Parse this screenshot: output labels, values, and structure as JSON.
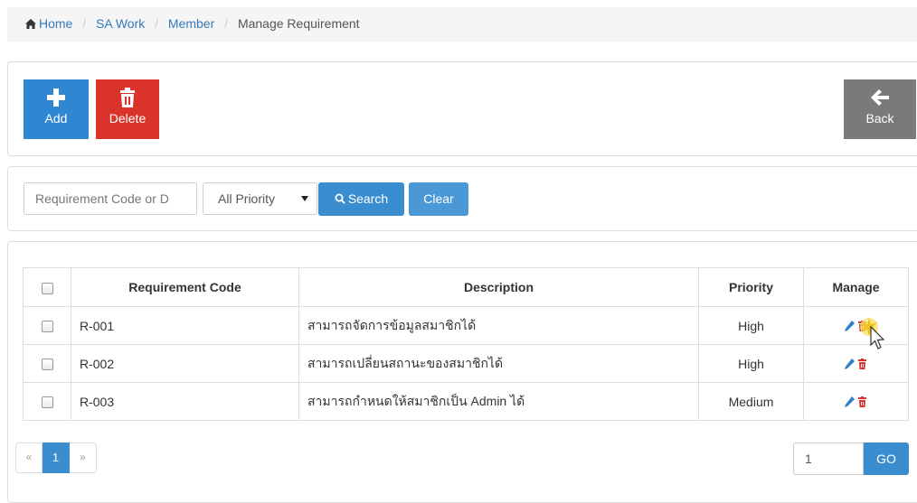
{
  "breadcrumb": {
    "items": [
      {
        "label": "Home",
        "icon": "home-icon"
      },
      {
        "label": "SA Work"
      },
      {
        "label": "Member"
      },
      {
        "label": "Manage Requirement"
      }
    ]
  },
  "toolbar": {
    "add_label": "Add",
    "delete_label": "Delete",
    "back_label": "Back"
  },
  "search": {
    "placeholder": "Requirement Code or D",
    "priority_selected": "All Priority",
    "search_label": "Search",
    "clear_label": "Clear"
  },
  "table": {
    "headers": {
      "code": "Requirement Code",
      "description": "Description",
      "priority": "Priority",
      "manage": "Manage"
    },
    "rows": [
      {
        "code": "R-001",
        "description": "สามารถจัดการข้อมูลสมาชิกได้",
        "priority": "High"
      },
      {
        "code": "R-002",
        "description": "สามารถเปลี่ยนสถานะของสมาชิกได้",
        "priority": "High"
      },
      {
        "code": "R-003",
        "description": "สามารถกำหนดให้สมาชิกเป็น Admin ได้",
        "priority": "Medium"
      }
    ]
  },
  "pagination": {
    "prev": "«",
    "current": "1",
    "next": "»",
    "goto_value": "1",
    "go_label": "GO"
  },
  "colors": {
    "primary": "#2f86d3",
    "danger": "#d9332b",
    "back": "#7a7a7a"
  }
}
